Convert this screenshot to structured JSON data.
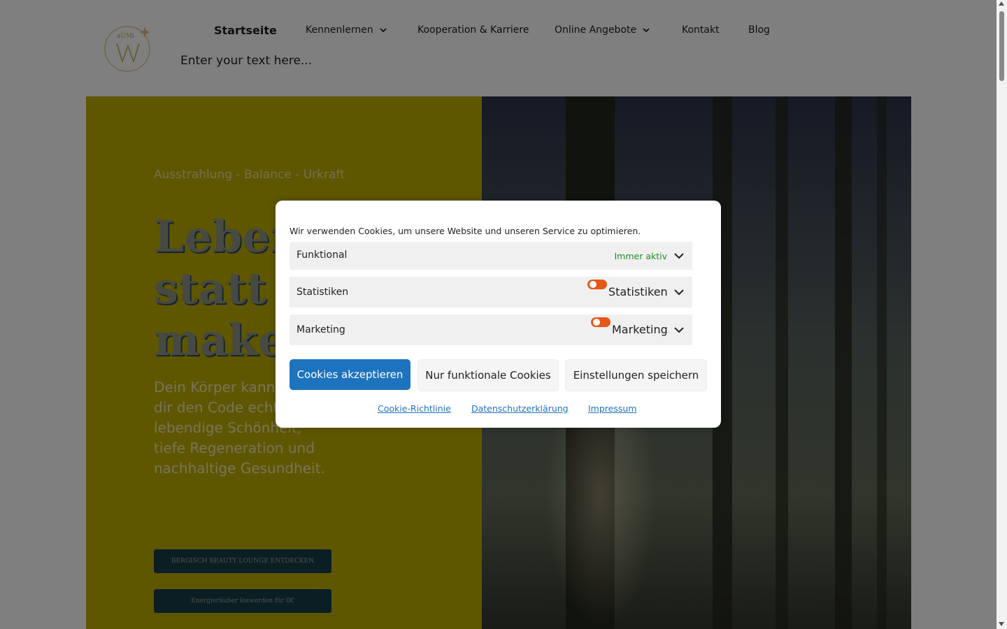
{
  "header": {
    "nav": [
      {
        "label": "Startseite",
        "active": true,
        "has_dropdown": false
      },
      {
        "label": "Kennenlernen",
        "has_dropdown": true
      },
      {
        "label": "Kooperation & Karriere",
        "has_dropdown": false
      },
      {
        "label": "Online Angebote",
        "has_dropdown": true
      },
      {
        "label": "Kontakt",
        "has_dropdown": false
      },
      {
        "label": "Blog",
        "has_dropdown": false
      }
    ],
    "search_placeholder": "Enter your text here...",
    "logo_text": "aUMi"
  },
  "hero": {
    "tagline": "Ausstrahlung - Balance - Urkraft",
    "headline": "Lebend\nstatt n\nmakell",
    "lead": "Dein Körper kann a zeige dir den Code echte lebendige Schönheit, tiefe Regeneration und nachhaltige Gesundheit.",
    "cta1": "BERGISCH BEAUTY LOUNGE ENTDECKEN",
    "cta2": "Energieräuber  loswerden für 0€",
    "colors": {
      "left_bg": "#bfad00",
      "cta_bg": "#173d49"
    }
  },
  "cookie": {
    "message": "Wir verwenden Cookies, um unsere Website und unseren Service zu optimieren.",
    "categories": [
      {
        "label": "Funktional",
        "status": "Immer aktiv"
      },
      {
        "label": "Statistiken",
        "toggle_label": "Statistiken"
      },
      {
        "label": "Marketing",
        "toggle_label": "Marketing"
      }
    ],
    "buttons": {
      "accept": "Cookies akzeptieren",
      "functional_only": "Nur funktionale Cookies",
      "save": "Einstellungen speichern"
    },
    "links": [
      "Cookie-Richtlinie",
      "Datenschutzerklärung",
      "Impressum"
    ],
    "colors": {
      "primary": "#1e73be",
      "toggle": "#e65718",
      "status": "#1e8f22"
    }
  }
}
